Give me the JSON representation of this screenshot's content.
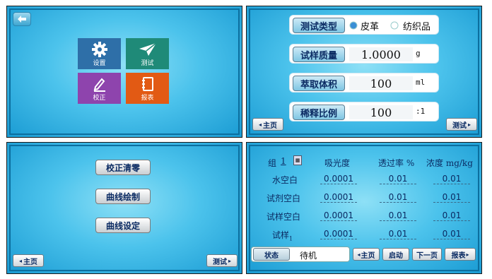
{
  "panel_home": {
    "tiles": [
      {
        "label": "设置",
        "icon": "gear-icon",
        "color": "#2e6fa8"
      },
      {
        "label": "测试",
        "icon": "paper-plane-icon",
        "color": "#1f8a78"
      },
      {
        "label": "校正",
        "icon": "pen-icon",
        "color": "#8e44ad"
      },
      {
        "label": "报表",
        "icon": "notebook-icon",
        "color": "#e25a14"
      }
    ]
  },
  "panel_settings": {
    "test_type_label": "测试类型",
    "test_type_options": [
      "皮革",
      "纺织品"
    ],
    "mass_label": "试样质量",
    "mass_value": "1.0000",
    "mass_unit": "g",
    "volume_label": "萃取体积",
    "volume_value": "100",
    "volume_unit": "ml",
    "dilution_label": "稀释比例",
    "dilution_value": "100",
    "dilution_unit": ":1",
    "home_button": "主页",
    "test_button": "测试"
  },
  "panel_calibration": {
    "buttons": [
      "校正清零",
      "曲线绘制",
      "曲线设定"
    ],
    "home_button": "主页",
    "test_button": "测试"
  },
  "panel_test": {
    "group_label": "组",
    "group_value": "1",
    "headers": [
      "吸光度",
      "透过率 %",
      "浓度 mg/kg"
    ],
    "rows": [
      {
        "label": "水空白",
        "values": [
          "0.0001",
          "0.01",
          "0.01"
        ]
      },
      {
        "label": "试剂空白",
        "values": [
          "0.0001",
          "0.01",
          "0.01"
        ]
      },
      {
        "label": "试样空白",
        "values": [
          "0.0001",
          "0.01",
          "0.01"
        ]
      },
      {
        "label": "试样",
        "sub": "1",
        "values": [
          "0.0001",
          "0.01",
          "0.01"
        ]
      }
    ],
    "status_label": "状态",
    "status_value": "待机",
    "buttons": [
      "主页",
      "启动",
      "下一页",
      "报表"
    ]
  }
}
